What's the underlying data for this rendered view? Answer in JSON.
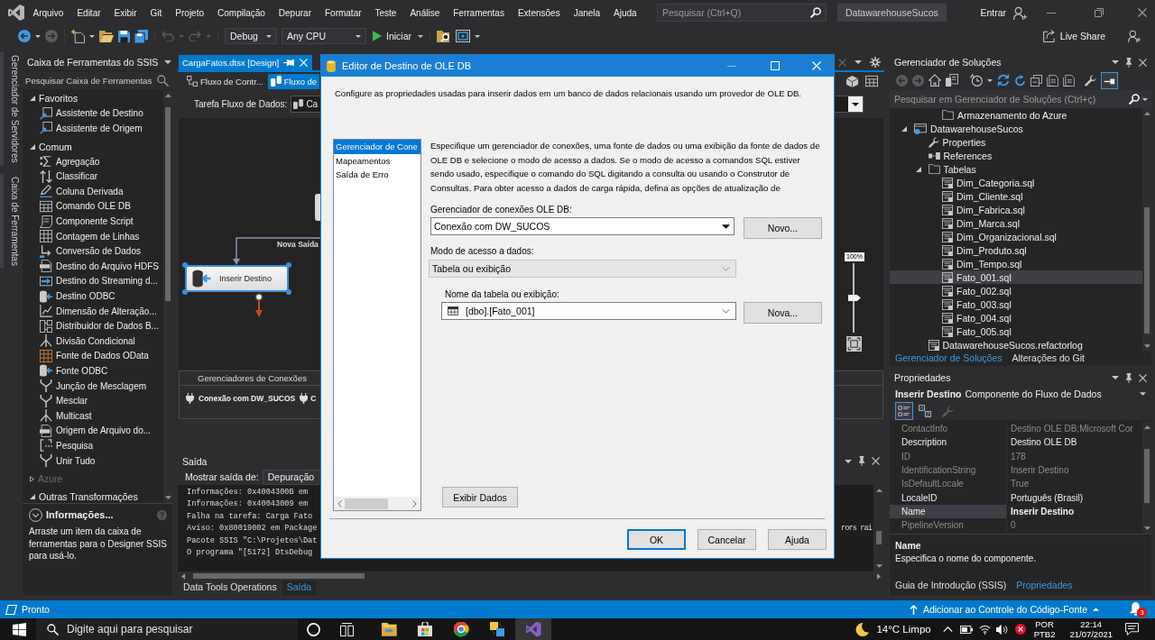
{
  "menu_bar": {
    "items": [
      "Arquivo",
      "Editar",
      "Exibir",
      "Git",
      "Projeto",
      "Compilação",
      "Depurar",
      "Formatar",
      "Teste",
      "Análise",
      "Ferramentas",
      "Extensões",
      "Janela",
      "Ajuda"
    ],
    "search": {
      "placeholder": "Pesquisar (Ctrl+Q)"
    },
    "solution_name": "DatawarehouseSucos",
    "sign_in": "Entrar"
  },
  "toolbar": {
    "configuration": "Debug",
    "platform": "Any CPU",
    "start": "Iniciar",
    "live_share": "Live Share"
  },
  "side_tabs": [
    "Gerenciador de Servidores",
    "Caixa de Ferramentas"
  ],
  "toolbox": {
    "title": "Caixa de Ferramentas do SSIS",
    "search": {
      "placeholder": "Pesquisar Caixa de Ferramentas"
    },
    "groups": [
      {
        "label": "Favoritos",
        "expanded": true,
        "disabled": false,
        "children": [
          {
            "label": "Assistente de Destino"
          },
          {
            "label": "Assistente de Origem"
          }
        ]
      },
      {
        "label": "Comum",
        "expanded": true,
        "disabled": false,
        "children": [
          {
            "label": "Agregação"
          },
          {
            "label": "Classificar"
          },
          {
            "label": "Coluna Derivada"
          },
          {
            "label": "Comando OLE DB"
          },
          {
            "label": "Componente Script"
          },
          {
            "label": "Contagem de Linhas"
          },
          {
            "label": "Conversão de Dados"
          },
          {
            "label": "Destino do Arquivo HDFS"
          },
          {
            "label": "Destino do Streaming d..."
          },
          {
            "label": "Destino ODBC"
          },
          {
            "label": "Dimensão de Alteração..."
          },
          {
            "label": "Distribuidor de Dados B..."
          },
          {
            "label": "Divisão Condicional"
          },
          {
            "label": "Fonte de Dados OData"
          },
          {
            "label": "Fonte ODBC"
          },
          {
            "label": "Junção de Mesclagem"
          },
          {
            "label": "Mesclar"
          },
          {
            "label": "Multicast"
          },
          {
            "label": "Origem de Arquivo do..."
          },
          {
            "label": "Pesquisa"
          },
          {
            "label": "Unir Tudo"
          }
        ]
      },
      {
        "label": "Azure",
        "expanded": false,
        "disabled": true
      },
      {
        "label": "Outras Transformações",
        "expanded": true,
        "disabled": false
      }
    ],
    "info": {
      "title": "Informações...",
      "text": "Arraste um item da caixa de ferramentas para o Designer SSIS para usá-lo."
    }
  },
  "document": {
    "tabs": [
      {
        "label": "CargaFatos.dtsx [Design]",
        "selected": true
      }
    ],
    "designer_tabs": [
      {
        "label": "Fluxo de Contr...",
        "selected": false
      },
      {
        "label": "Fluxo de",
        "selected": true
      }
    ],
    "task": {
      "label": "Tarefa Fluxo de Dados:",
      "value": "Ca"
    },
    "canvas": {
      "path_label": "Nova Saída",
      "component": {
        "label": "Inserir Destino",
        "selected": true
      },
      "zoom": {
        "label": "100%",
        "level": 0.5
      }
    },
    "connection_managers": {
      "title": "Gerenciadores de Conexões",
      "items": [
        "Conexão com DW_SUCOS",
        "C"
      ]
    }
  },
  "output": {
    "title": "Saída",
    "source_label": "Mostrar saída de:",
    "source": "Depuração",
    "lines": [
      {
        "text": "Informações: 0x4004300B em"
      },
      {
        "text": "Informações: 0x40043009 em"
      },
      {
        "text": "Falha na tarefa: Carga Fato"
      },
      {
        "text": "Aviso: 0x80019002 em Package",
        "tail": "rors rai"
      },
      {
        "text": "Pacote SSIS \"C:\\Projetos\\Dat"
      },
      {
        "text": "O programa \"[5172] DtsDebug"
      }
    ],
    "tabs": [
      {
        "label": "Data Tools Operations",
        "selected": false
      },
      {
        "label": "Saída",
        "selected": true
      }
    ]
  },
  "dialog": {
    "title": "Editor de Destino de OLE DB",
    "description": "Configure as propriedades usadas para inserir dados em um banco de dados relacionais usando um provedor de OLE DB.",
    "nav": [
      {
        "label": "Gerenciador de Cone",
        "selected": true
      },
      {
        "label": "Mapeamentos",
        "selected": false
      },
      {
        "label": "Saída de Erro",
        "selected": false
      }
    ],
    "intro": "Especifique um gerenciador de conexões, uma fonte de dados ou uma exibição da fonte de dados de OLE DB e selecione o modo de acesso a dados. Se o modo de acesso a comandos SQL estiver sendo usado, especifique o comando do SQL digitando a consulta ou usando o Construtor de Consultas. Para obter acesso a dados de carga rápida, defina as opções de atualização de",
    "connection": {
      "label": "Gerenciador de conexões OLE DB:",
      "value": "Conexão com DW_SUCOS",
      "button": "Novo..."
    },
    "access_mode": {
      "label": "Modo de acesso a dados:",
      "value": "Tabela ou exibição"
    },
    "table": {
      "label": "Nome da tabela ou exibição:",
      "value": "[dbo].[Fato_001]",
      "button": "Nova..."
    },
    "preview_button": "Exibir Dados",
    "buttons": [
      {
        "label": "OK",
        "default": true
      },
      {
        "label": "Cancelar",
        "default": false
      },
      {
        "label": "Ajuda",
        "default": false
      }
    ]
  },
  "solution_explorer": {
    "title": "Gerenciador de Soluções",
    "search": {
      "placeholder": "Pesquisar em Gerenciador de Soluções (Ctrl+ç)"
    },
    "tree": [
      {
        "children": [
          {
            "children": [
              {
                "label": "Armazenamento do Azure",
                "kind": "folder",
                "selected": false
              }
            ]
          }
        ]
      },
      {
        "label": "DatawarehouseSucos",
        "kind": "project",
        "expanded": true,
        "selected": false,
        "children": [
          {
            "label": "Properties",
            "kind": "properties",
            "selected": false
          },
          {
            "label": "References",
            "kind": "references",
            "selected": false
          },
          {
            "label": "Tabelas",
            "kind": "folder",
            "expanded": true,
            "selected": false,
            "children": [
              {
                "label": "Dim_Categoria.sql",
                "kind": "file",
                "selected": false
              },
              {
                "label": "Dim_Cliente.sql",
                "kind": "file",
                "selected": false
              },
              {
                "label": "Dim_Fabrica.sql",
                "kind": "file",
                "selected": false
              },
              {
                "label": "Dim_Marca.sql",
                "kind": "file",
                "selected": false
              },
              {
                "label": "Dim_Organizacional.sql",
                "kind": "file",
                "selected": false
              },
              {
                "label": "Dim_Produto.sql",
                "kind": "file",
                "selected": false
              },
              {
                "label": "Dim_Tempo.sql",
                "kind": "file",
                "selected": false
              },
              {
                "label": "Fato_001.sql",
                "kind": "file",
                "selected": true
              },
              {
                "label": "Fato_002.sql",
                "kind": "file",
                "selected": false
              },
              {
                "label": "Fato_003.sql",
                "kind": "file",
                "selected": false
              },
              {
                "label": "Fato_004.sql",
                "kind": "file",
                "selected": false
              },
              {
                "label": "Fato_005.sql",
                "kind": "file",
                "selected": false
              }
            ]
          },
          {
            "label": "DatawarehouseSucos.refactorlog",
            "kind": "file",
            "selected": false
          }
        ]
      }
    ],
    "tabs": [
      {
        "label": "Gerenciador de Soluções",
        "selected": true
      },
      {
        "label": "Alterações do Git",
        "selected": false
      }
    ]
  },
  "properties": {
    "title": "Propriedades",
    "object": {
      "name": "Inserir Destino",
      "type": "Componente do Fluxo de Dados"
    },
    "rows": [
      {
        "name": "ContactInfo",
        "value": "Destino OLE DB;Microsoft Cor",
        "disabled": true,
        "modified": false,
        "selected": false
      },
      {
        "name": "Description",
        "value": "Destino OLE DB",
        "disabled": false,
        "modified": false,
        "selected": false
      },
      {
        "name": "ID",
        "value": "178",
        "disabled": true,
        "modified": false,
        "selected": false
      },
      {
        "name": "IdentificationString",
        "value": "Inserir Destino",
        "disabled": true,
        "modified": false,
        "selected": false
      },
      {
        "name": "IsDefaultLocale",
        "value": "True",
        "disabled": true,
        "modified": false,
        "selected": false
      },
      {
        "name": "LocaleID",
        "value": "Português (Brasil)",
        "disabled": false,
        "modified": false,
        "selected": false
      },
      {
        "name": "Name",
        "value": "Inserir Destino",
        "disabled": false,
        "modified": true,
        "selected": true
      },
      {
        "name": "PipelineVersion",
        "value": "0",
        "disabled": true,
        "modified": false,
        "selected": false
      }
    ],
    "help": {
      "title": "Name",
      "text": "Especifica o nome do componente."
    },
    "tabs": [
      {
        "label": "Guia de Introdução (SSIS)",
        "selected": false
      },
      {
        "label": "Propriedades",
        "selected": true
      }
    ]
  },
  "status_bar": {
    "text": "Pronto",
    "source_control": "Adicionar ao Controle do Código-Fonte",
    "notifications": "3"
  },
  "taskbar": {
    "search": {
      "placeholder": "Digite aqui para pesquisar"
    },
    "apps": [
      {
        "selected": false
      },
      {
        "selected": false
      },
      {
        "selected": false
      },
      {
        "selected": false
      },
      {
        "selected": true
      }
    ],
    "weather": "14°C Limpo",
    "language": "POR",
    "keyboard": "PTB2",
    "time": "22:14",
    "date": "21/07/2021"
  }
}
